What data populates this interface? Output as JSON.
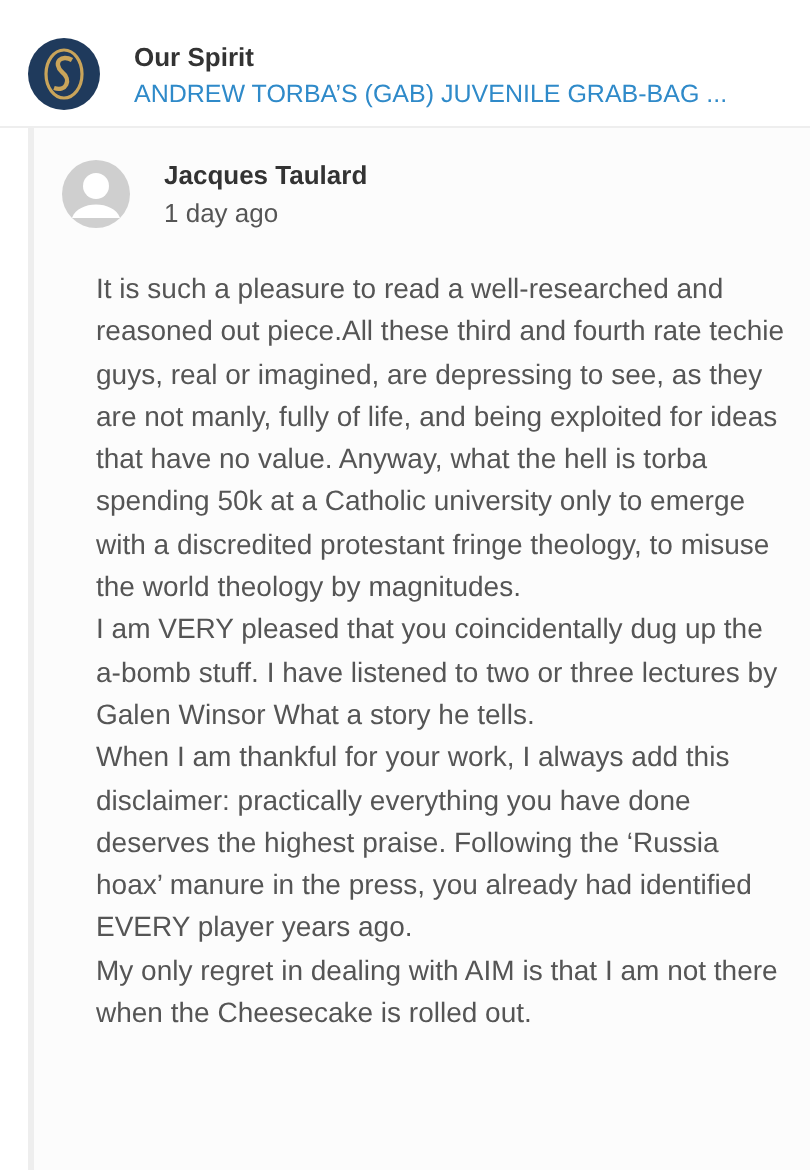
{
  "site": {
    "name": "Our Spirit",
    "article_link": "ANDREW TORBA’S (GAB) JUVENILE GRAB-BAG ..."
  },
  "comment": {
    "author": "Jacques Taulard",
    "time": "1 day ago",
    "paragraphs": [
      "It is such a pleasure to read a well-researched and reasoned out piece.All these third and fourth rate techie guys, real or imagined, are depressing to see, as they are not manly, fully of life, and being exploited for ideas that have no value. Anyway, what the hell is torba spending 50k at a Catholic university only to emerge with a discredited protestant fringe theology, to misuse the world theology by magnitudes.",
      "I am VERY pleased that you coincidentally dug up the a-bomb stuff. I have listened to two or three lectures by Galen Winsor What a story he tells.",
      "When I am thankful for your work, I always add this disclaimer: practically everything you have done deserves the highest praise. Following the ‘Russia hoax’ manure in the press, you already had identified EVERY player years ago.",
      "My only regret in dealing with AIM is that I am not there when the Cheesecake is rolled out."
    ]
  }
}
